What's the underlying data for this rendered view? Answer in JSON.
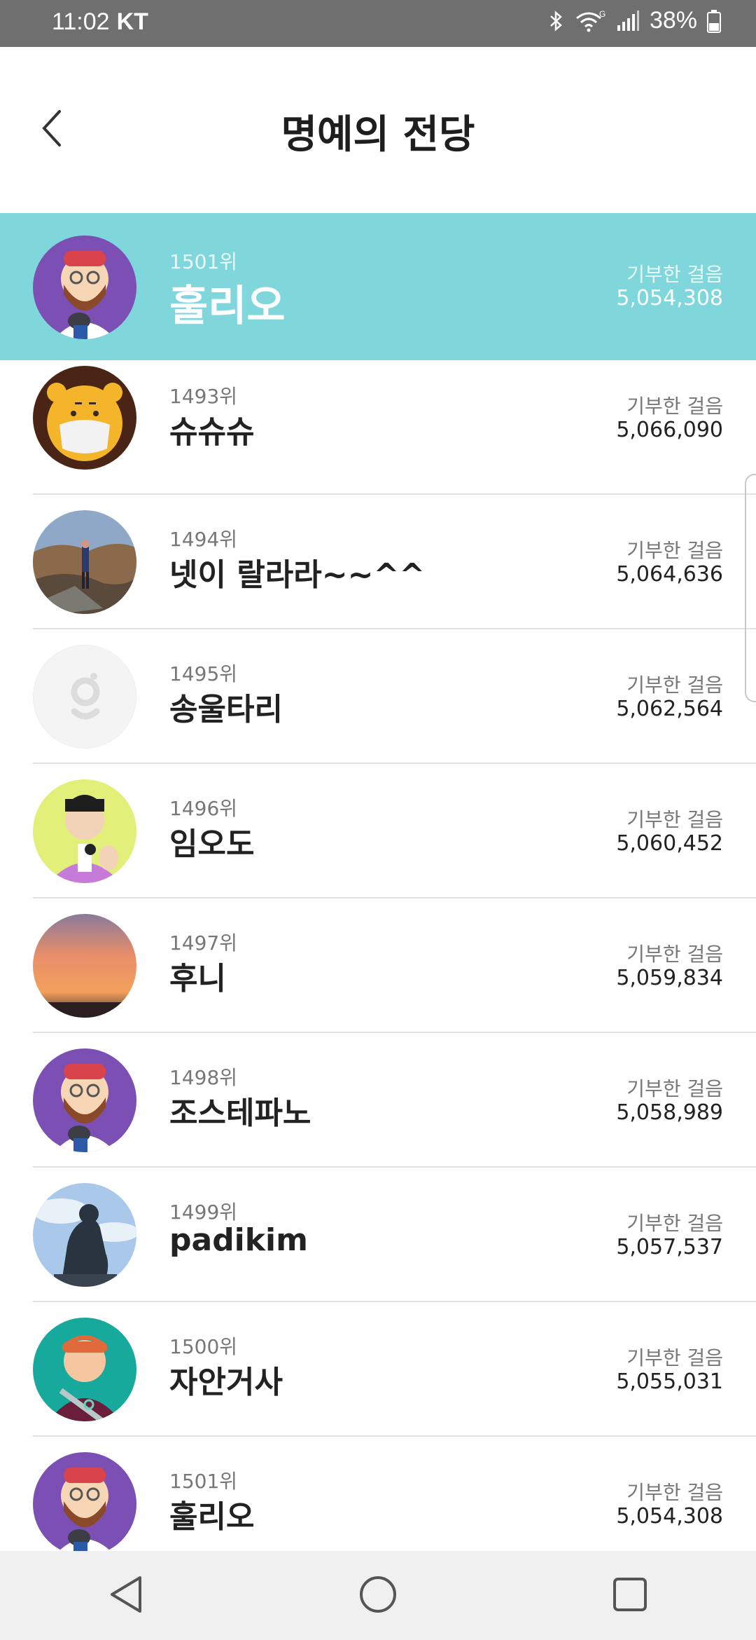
{
  "status_bar": {
    "time": "11:02",
    "carrier": "KT",
    "battery": "38%"
  },
  "header": {
    "title": "명예의 전당"
  },
  "steps_label": "기부한 걸음",
  "my_rank": {
    "rank": "1501위",
    "name": "훌리오",
    "steps": "5,054,308"
  },
  "ranking": [
    {
      "rank": "1493위",
      "name": "슈슈슈",
      "steps": "5,066,090"
    },
    {
      "rank": "1494위",
      "name": "넷이 랄라라~~^^",
      "steps": "5,064,636"
    },
    {
      "rank": "1495위",
      "name": "송울타리",
      "steps": "5,062,564"
    },
    {
      "rank": "1496위",
      "name": "임오도",
      "steps": "5,060,452"
    },
    {
      "rank": "1497위",
      "name": "후니",
      "steps": "5,059,834"
    },
    {
      "rank": "1498위",
      "name": "조스테파노",
      "steps": "5,058,989"
    },
    {
      "rank": "1499위",
      "name": "padikim",
      "steps": "5,057,537"
    },
    {
      "rank": "1500위",
      "name": "자안거사",
      "steps": "5,055,031"
    },
    {
      "rank": "1501위",
      "name": "훌리오",
      "steps": "5,054,308"
    }
  ],
  "colors": {
    "highlight": "#7fd7dc",
    "status_bar": "#6f6f6f",
    "nav_bar": "#f0f0f0"
  }
}
